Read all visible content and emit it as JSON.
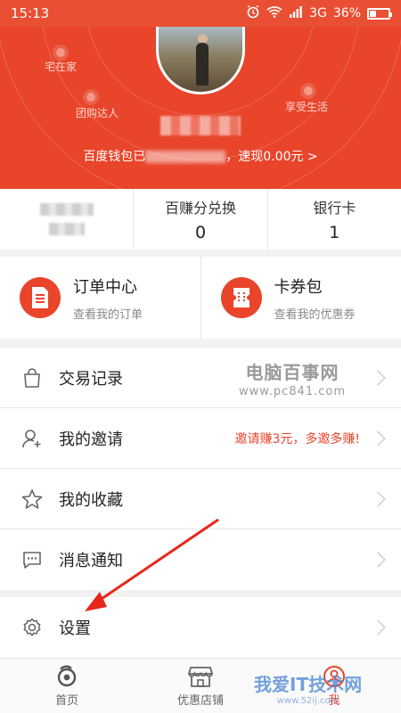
{
  "status_bar": {
    "time": "15:13",
    "network": "3G",
    "battery": "36%",
    "battery_level": 0.36
  },
  "header": {
    "tags": [
      "宅在家",
      "团购达人",
      "享受生活"
    ],
    "wallet_line_prefix": "百度钱包已",
    "wallet_line_suffix": "，速现0.00元 >"
  },
  "stats": [
    {
      "label": "百赚分兑换",
      "value": "0"
    },
    {
      "label": "银行卡",
      "value": "1"
    }
  ],
  "cards": [
    {
      "title": "订单中心",
      "subtitle": "查看我的订单",
      "icon": "document-icon"
    },
    {
      "title": "卡券包",
      "subtitle": "查看我的优惠券",
      "icon": "ticket-icon"
    }
  ],
  "menu_group1": [
    {
      "label": "交易记录",
      "icon": "shopping-bag-icon",
      "extra": ""
    },
    {
      "label": "我的邀请",
      "icon": "add-person-icon",
      "extra": "邀请赚3元，多邀多赚!"
    },
    {
      "label": "我的收藏",
      "icon": "star-icon",
      "extra": ""
    },
    {
      "label": "消息通知",
      "icon": "message-icon",
      "extra": ""
    }
  ],
  "menu_group2": [
    {
      "label": "设置",
      "icon": "gear-icon",
      "extra": ""
    }
  ],
  "watermark": {
    "title": "电脑百事网",
    "url": "www.pc841.com"
  },
  "watermark2": {
    "title": "我爱IT技术网",
    "url": "www.52ij.com"
  },
  "tabbar": [
    {
      "label": "首页",
      "icon": "home-icon",
      "active": false
    },
    {
      "label": "优惠店铺",
      "icon": "store-icon",
      "active": false
    },
    {
      "label": "我",
      "icon": "person-icon",
      "active": true
    }
  ],
  "colors": {
    "accent": "#e8452b",
    "header": "#e8452b"
  }
}
